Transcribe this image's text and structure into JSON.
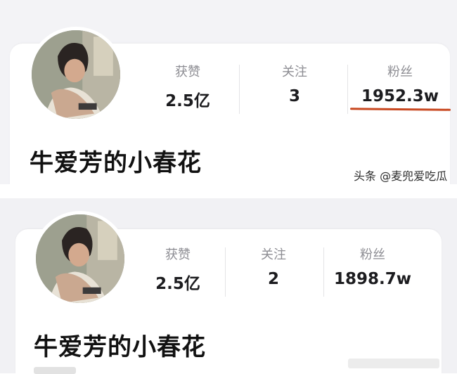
{
  "top_profile": {
    "nickname": "牛爱芳的小春花",
    "stats": [
      {
        "label": "获赞",
        "value": "2.5亿"
      },
      {
        "label": "关注",
        "value": "3"
      },
      {
        "label": "粉丝",
        "value": "1952.3w"
      }
    ]
  },
  "bottom_profile": {
    "nickname": "牛爱芳的小春花",
    "stats": [
      {
        "label": "获赞",
        "value": "2.5亿"
      },
      {
        "label": "关注",
        "value": "2"
      },
      {
        "label": "粉丝",
        "value": "1898.7w"
      }
    ]
  },
  "watermark": "头条 @麦兜爱吃瓜",
  "colors": {
    "underline": "#c8471f",
    "label": "#8d8d93",
    "value": "#1c1c1f"
  },
  "icons": [
    "avatar-photo"
  ]
}
